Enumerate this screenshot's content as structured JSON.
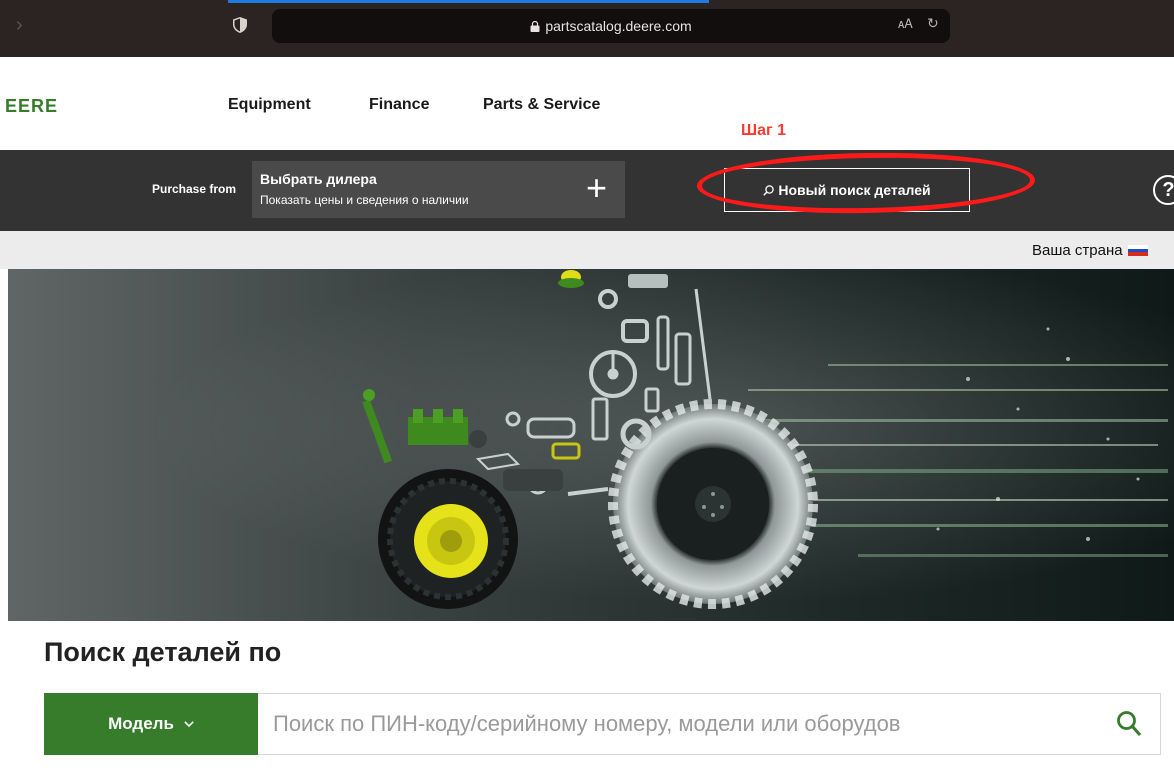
{
  "browser": {
    "url": "partscatalog.deere.com"
  },
  "header": {
    "brand": "EERE",
    "nav": [
      "Equipment",
      "Finance",
      "Parts & Service"
    ]
  },
  "annotation": {
    "step_label": "Шаг 1",
    "color": "#ff1a1a"
  },
  "toolbar": {
    "purchase_from": "Purchase from",
    "dealer_title": "Выбрать дилера",
    "dealer_subtitle": "Показать цены и сведения о наличии",
    "dealer_action_icon": "plus-icon",
    "new_search_label": "Новый поиск деталей",
    "help_label": "?"
  },
  "country": {
    "label": "Ваша страна",
    "flag": "russia-flag-icon"
  },
  "hero": {
    "image": "tractor made of parts banner"
  },
  "search": {
    "heading": "Поиск деталей по",
    "mode_label": "Модель",
    "placeholder": "Поиск по ПИН-коду/серийному номеру, модели или оборудов"
  },
  "colors": {
    "brand_green": "#367c2b",
    "toolbar_bg": "#333333",
    "annotation_red": "#ff3b30"
  }
}
